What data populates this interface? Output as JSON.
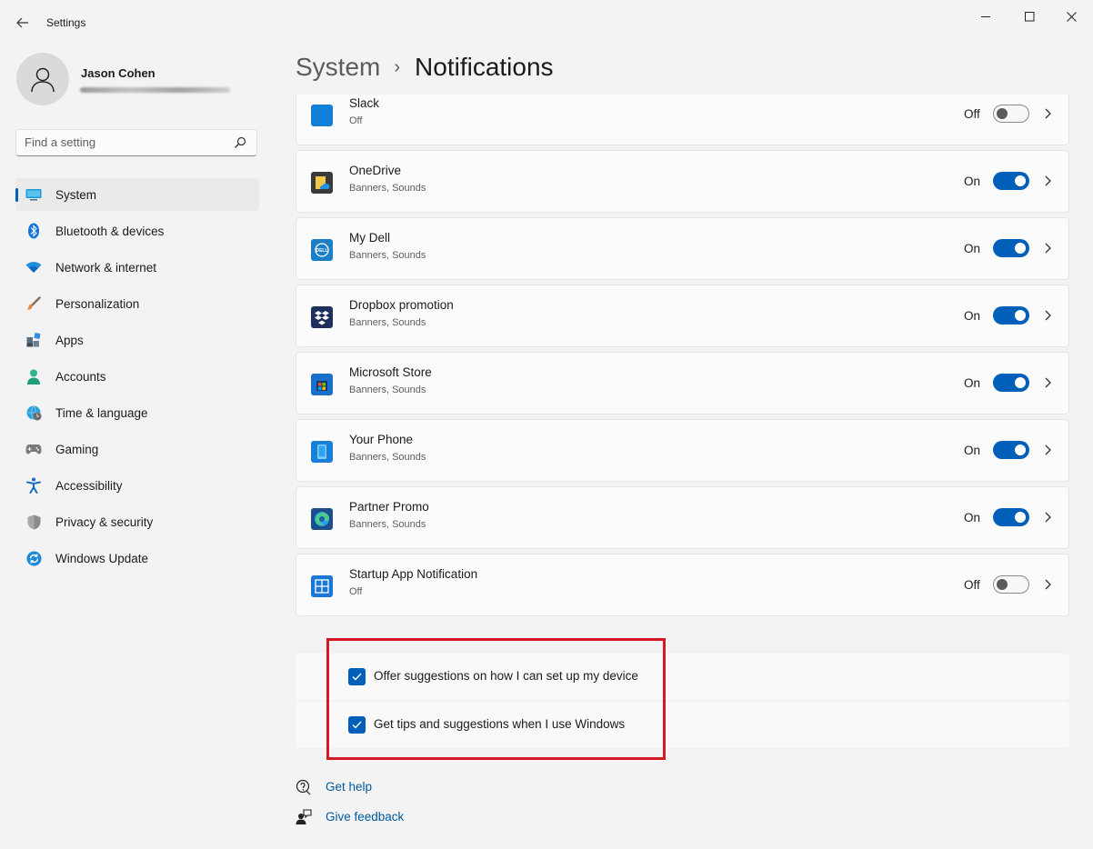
{
  "window": {
    "title": "Settings",
    "accent": "#005fb8"
  },
  "profile": {
    "name": "Jason Cohen"
  },
  "search": {
    "placeholder": "Find a setting"
  },
  "nav": {
    "items": [
      {
        "label": "System",
        "icon": "system-icon",
        "active": true
      },
      {
        "label": "Bluetooth & devices",
        "icon": "bluetooth-icon"
      },
      {
        "label": "Network & internet",
        "icon": "wifi-icon"
      },
      {
        "label": "Personalization",
        "icon": "brush-icon"
      },
      {
        "label": "Apps",
        "icon": "apps-icon"
      },
      {
        "label": "Accounts",
        "icon": "person-icon"
      },
      {
        "label": "Time & language",
        "icon": "globe-clock-icon"
      },
      {
        "label": "Gaming",
        "icon": "gamepad-icon"
      },
      {
        "label": "Accessibility",
        "icon": "accessibility-icon"
      },
      {
        "label": "Privacy & security",
        "icon": "shield-icon"
      },
      {
        "label": "Windows Update",
        "icon": "update-icon"
      }
    ]
  },
  "header": {
    "parent": "System",
    "separator": "›",
    "current": "Notifications"
  },
  "apps": [
    {
      "name": "Slack",
      "sub": "Off",
      "state": "Off",
      "on": false,
      "icon": "slack-icon"
    },
    {
      "name": "OneDrive",
      "sub": "Banners, Sounds",
      "state": "On",
      "on": true,
      "icon": "onedrive-icon"
    },
    {
      "name": "My Dell",
      "sub": "Banners, Sounds",
      "state": "On",
      "on": true,
      "icon": "dell-icon"
    },
    {
      "name": "Dropbox promotion",
      "sub": "Banners, Sounds",
      "state": "On",
      "on": true,
      "icon": "dropbox-icon"
    },
    {
      "name": "Microsoft Store",
      "sub": "Banners, Sounds",
      "state": "On",
      "on": true,
      "icon": "store-icon"
    },
    {
      "name": "Your Phone",
      "sub": "Banners, Sounds",
      "state": "On",
      "on": true,
      "icon": "phone-icon"
    },
    {
      "name": "Partner Promo",
      "sub": "Banners, Sounds",
      "state": "On",
      "on": true,
      "icon": "edge-icon"
    },
    {
      "name": "Startup App Notification",
      "sub": "Off",
      "state": "Off",
      "on": false,
      "icon": "startup-app-icon"
    }
  ],
  "suggestions": {
    "offer_label": "Offer suggestions on how I can set up my device",
    "offer_checked": true,
    "tips_label": "Get tips and suggestions when I use Windows",
    "tips_checked": true
  },
  "links": {
    "help": "Get help",
    "feedback": "Give feedback"
  }
}
